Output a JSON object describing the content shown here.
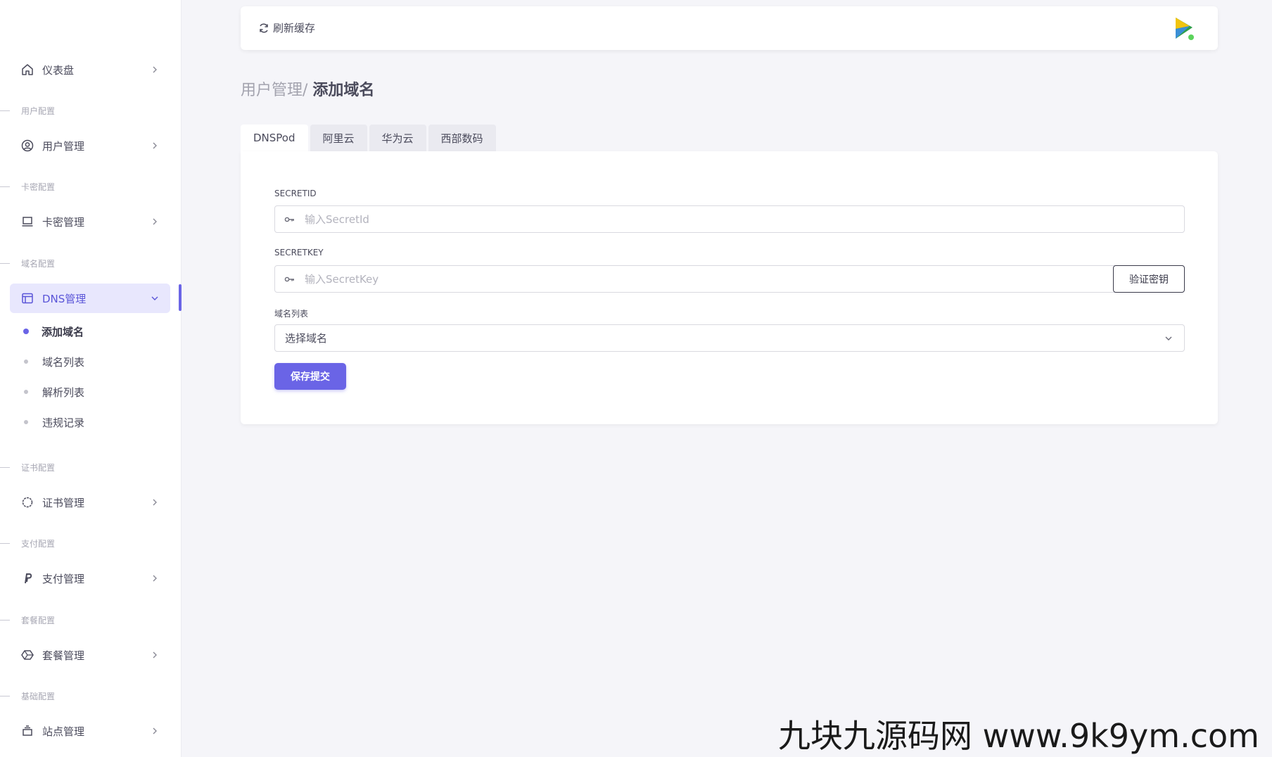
{
  "sidebar": {
    "dashboard": "仪表盘",
    "sections": {
      "user": "用户配置",
      "card": "卡密配置",
      "domain": "域名配置",
      "cert": "证书配置",
      "pay": "支付配置",
      "plan": "套餐配置",
      "base": "基础配置"
    },
    "items": {
      "user_mgmt": "用户管理",
      "card_mgmt": "卡密管理",
      "dns_mgmt": "DNS管理",
      "cert_mgmt": "证书管理",
      "pay_mgmt": "支付管理",
      "plan_mgmt": "套餐管理",
      "site_mgmt": "站点管理"
    },
    "dns_sub": {
      "add_domain": "添加域名",
      "domain_list": "域名列表",
      "resolve_list": "解析列表",
      "violations": "违规记录"
    }
  },
  "topbar": {
    "refresh_label": "刷新缓存"
  },
  "breadcrumb": {
    "parent": "用户管理/",
    "current": "添加域名"
  },
  "tabs": [
    "DNSPod",
    "阿里云",
    "华为云",
    "西部数码"
  ],
  "form": {
    "secret_id_label": "SECRETID",
    "secret_id_placeholder": "输入SecretId",
    "secret_key_label": "SECRETKEY",
    "secret_key_placeholder": "输入SecretKey",
    "verify_label": "验证密钥",
    "domain_list_label": "域名列表",
    "domain_select_value": "选择域名",
    "submit_label": "保存提交"
  },
  "colors": {
    "accent": "#6a64e6",
    "active_bg": "#e8e7fd",
    "page_bg": "#f5f5f9"
  },
  "watermark": "九块九源码网 www.9k9ym.com"
}
